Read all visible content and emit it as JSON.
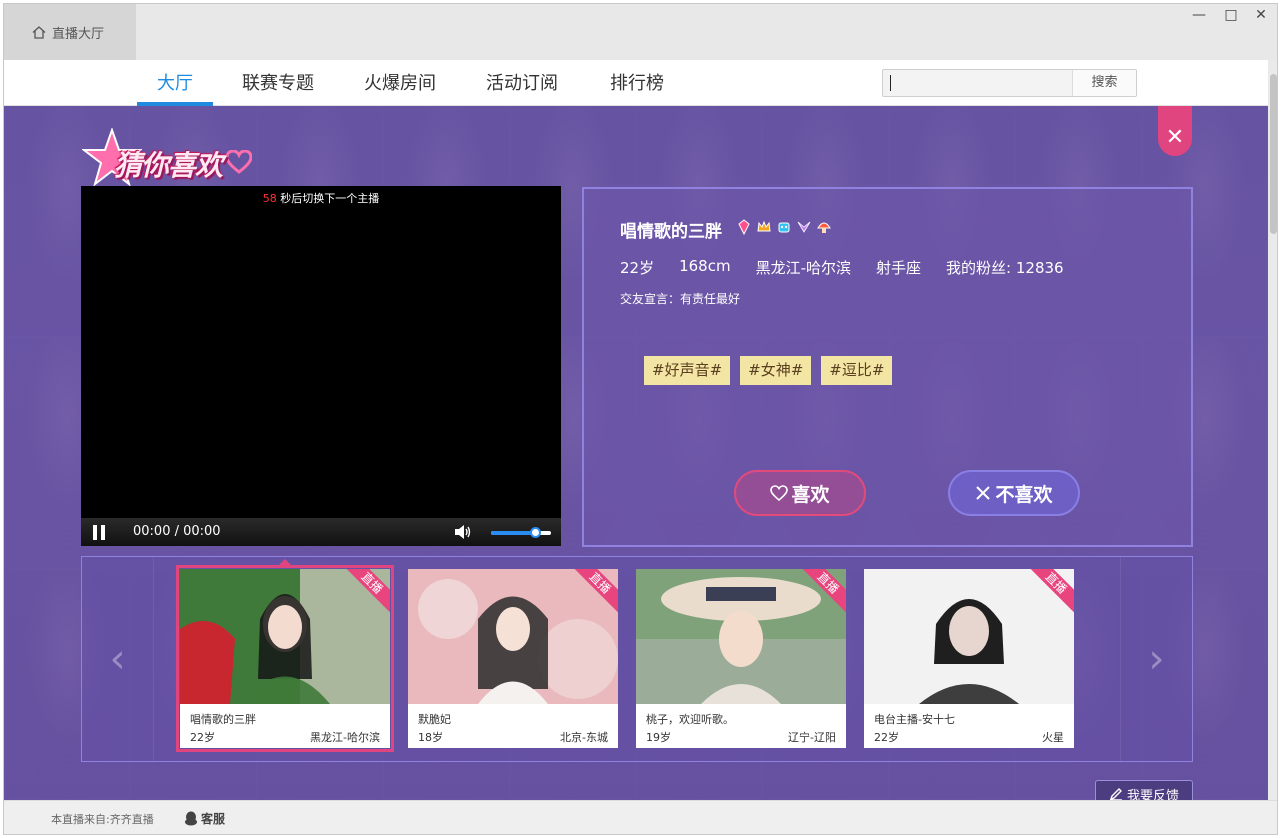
{
  "window": {
    "tab_label": "直播大厅",
    "controls": {
      "minimize": "—",
      "maximize": "□",
      "close": "✕"
    }
  },
  "nav": {
    "tabs": [
      {
        "label": "大厅",
        "active": true
      },
      {
        "label": "联赛专题",
        "active": false
      },
      {
        "label": "火爆房间",
        "active": false
      },
      {
        "label": "活动订阅",
        "active": false
      },
      {
        "label": "排行榜",
        "active": false
      }
    ],
    "search": {
      "value": "",
      "button_label": "搜索"
    }
  },
  "panel": {
    "logo_text": "猜你喜欢",
    "close_label": "✕",
    "player": {
      "countdown_seconds": "58",
      "countdown_text": "秒后切换下一个主播",
      "timecode": "00:00 / 00:00",
      "volume": 0.75
    },
    "anchor": {
      "name": "唱情歌的三胖",
      "badges": [
        "gem-badge-icon",
        "crown-badge-icon",
        "robot-badge-icon",
        "wings-badge-icon",
        "mushroom-badge-icon"
      ],
      "age": "22岁",
      "height": "168cm",
      "location": "黑龙江-哈尔滨",
      "zodiac": "射手座",
      "fans": "我的粉丝: 12836",
      "motto": "交友宣言：有责任最好",
      "tags": [
        "#好声音#",
        "#女神#",
        "#逗比#"
      ]
    },
    "buttons": {
      "like": "喜欢",
      "dislike": "不喜欢"
    }
  },
  "carousel": {
    "live_ribbon": "直播",
    "cards": [
      {
        "name": "唱情歌的三胖",
        "age": "22岁",
        "location": "黑龙江-哈尔滨",
        "selected": true,
        "palette": [
          "#3f7a3a",
          "#d9d1c7",
          "#c8272f"
        ]
      },
      {
        "name": "默脆妃",
        "age": "18岁",
        "location": "北京-东城",
        "selected": false,
        "palette": [
          "#e9b9bd",
          "#f3e7e4",
          "#2b2b2b"
        ]
      },
      {
        "name": "桃子，欢迎听歌。",
        "age": "19岁",
        "location": "辽宁-辽阳",
        "selected": false,
        "palette": [
          "#7fa27a",
          "#e9dccd",
          "#3a3f55"
        ]
      },
      {
        "name": "电台主播-安十七",
        "age": "22岁",
        "location": "火星",
        "selected": false,
        "palette": [
          "#f2f2f2",
          "#e6d6cf",
          "#1f1f1f"
        ]
      }
    ]
  },
  "feedback_label": "我要反馈",
  "footer": {
    "source": "本直播来自:齐齐直播",
    "service": "客服"
  }
}
